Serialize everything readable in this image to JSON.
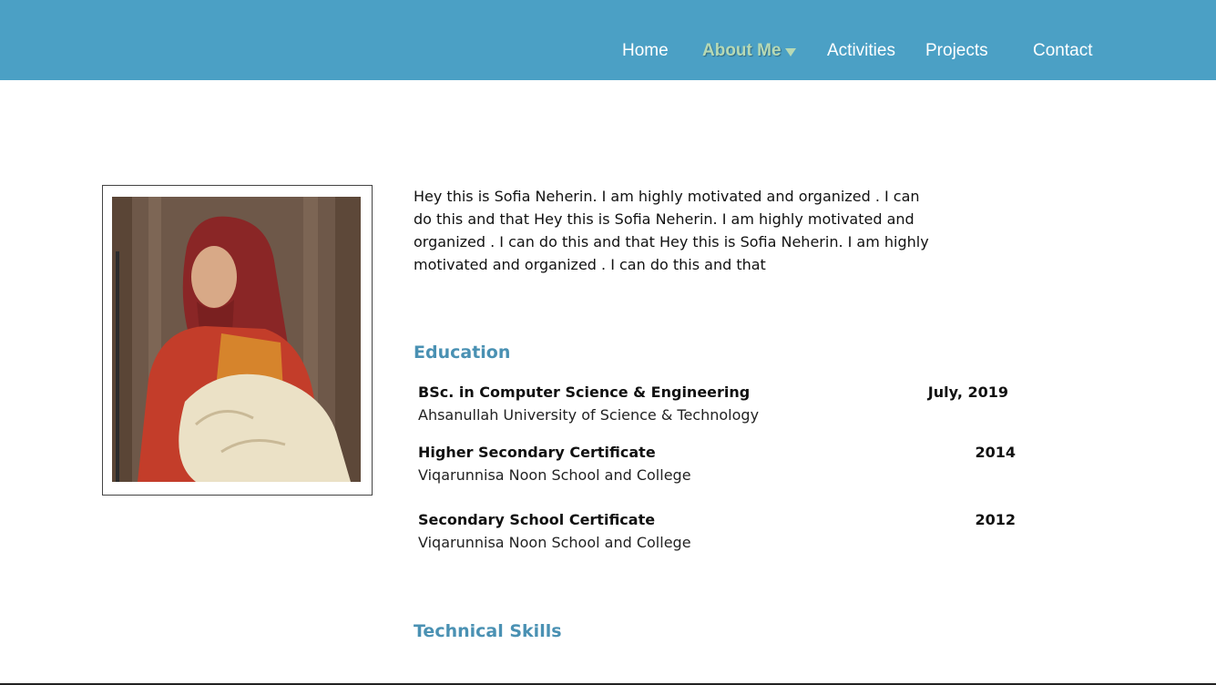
{
  "nav": {
    "items": [
      {
        "label": "Home"
      },
      {
        "label": "About Me",
        "active": true,
        "has_dropdown": true
      },
      {
        "label": "Activities"
      },
      {
        "label": "Projects"
      },
      {
        "label": "Contact"
      }
    ],
    "dropdown_icon": "caret-down-icon"
  },
  "colors": {
    "navbar": "#4ba0c5",
    "nav_active": "#b7d9b4",
    "section_title": "#4a91b3"
  },
  "profile": {
    "photo": "profile-photo",
    "intro": "Hey this is Sofia Neherin. I  am highly motivated and organized . I can do this and that Hey this is Sofia Neherin. I  am highly motivated and organized . I can do this and that Hey this is Sofia Neherin. I  am highly motivated and organized . I can do this and that"
  },
  "education": {
    "title": "Education",
    "items": [
      {
        "degree": "BSc. in Computer Science & Engineering",
        "school": "Ahsanullah University of Science & Technology",
        "date": "July, 2019"
      },
      {
        "degree": "Higher Secondary Certificate",
        "school": "Viqarunnisa Noon School and College",
        "date": "2014"
      },
      {
        "degree": "Secondary School Certificate",
        "school": "Viqarunnisa Noon School and College",
        "date": "2012"
      }
    ]
  },
  "skills": {
    "title": "Technical Skills"
  }
}
